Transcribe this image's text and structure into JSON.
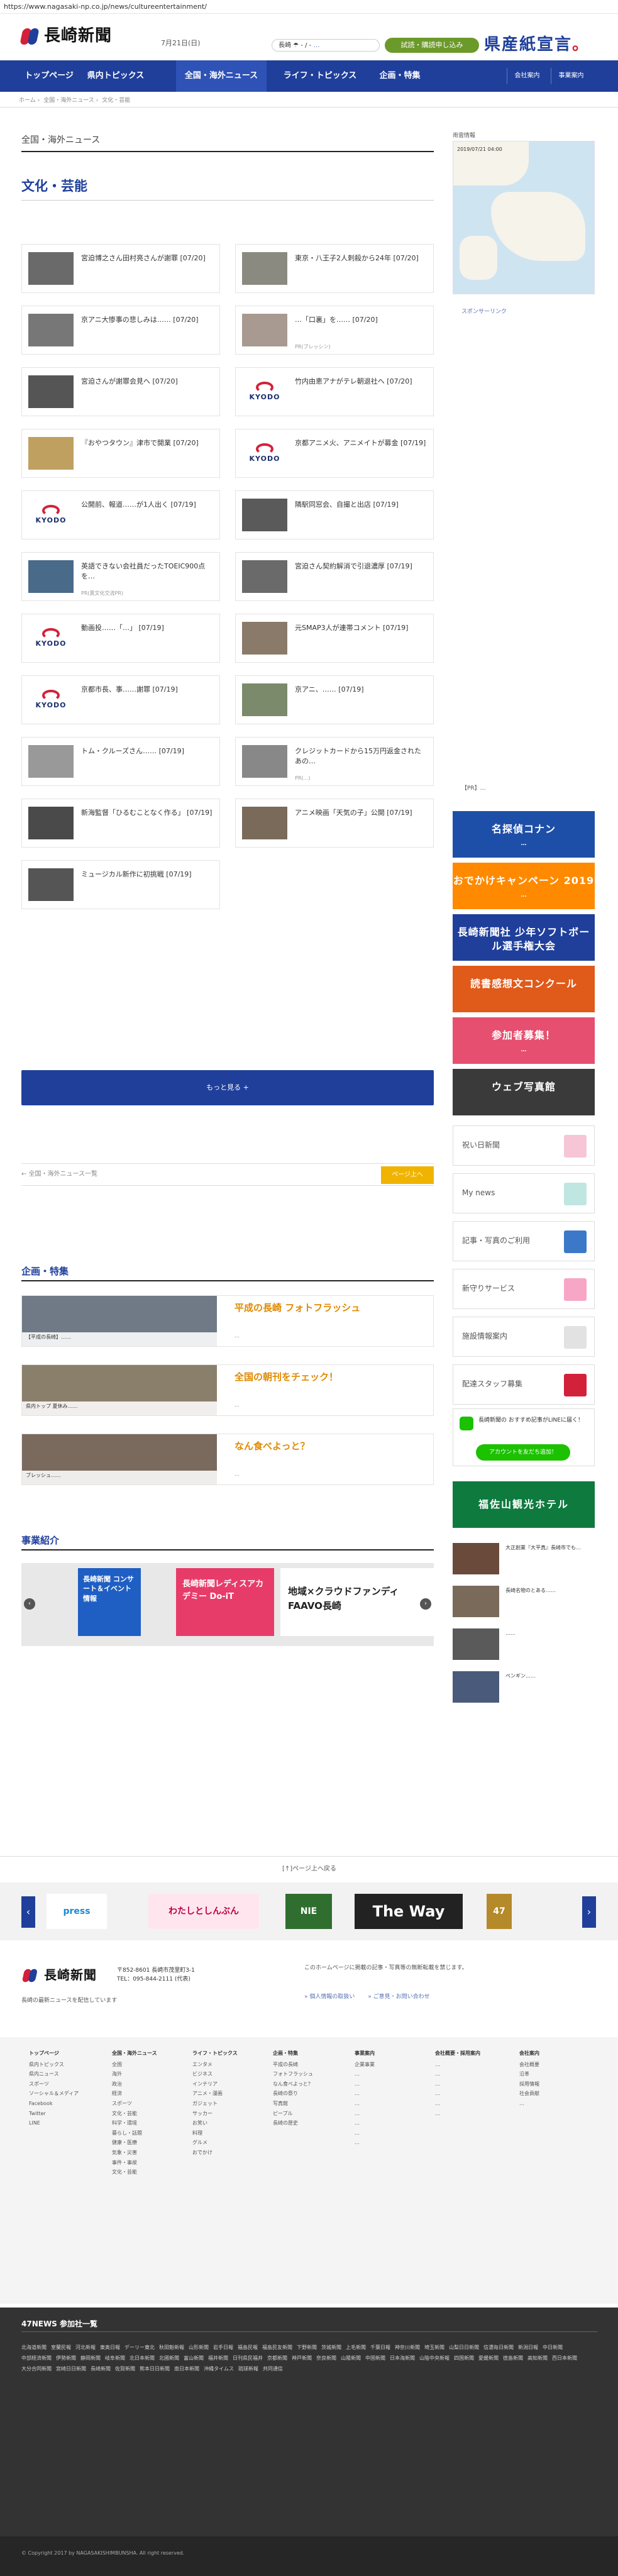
{
  "browser": {
    "url": "https://www.nagasaki-np.co.jp/news/cultureentertainment/"
  },
  "header": {
    "logo_text": "長崎新聞",
    "date": "7月21日(日)",
    "weather": "長崎 ☂ - / -",
    "weather_link": "…",
    "ad_pill": "試読・購読申し込み",
    "banner_main": "県産紙宣言",
    "banner_mark": "。"
  },
  "nav": {
    "items": [
      "トップページ",
      "県内トピックス",
      "全国・海外ニュース",
      "ライフ・トピックス",
      "企画・特集"
    ],
    "active_index": 2,
    "small": [
      "会社案内",
      "事業案内"
    ]
  },
  "breadcrumb": [
    "ホーム",
    "全国・海外ニュース",
    "文化・芸能"
  ],
  "main": {
    "section_label": "全国・海外ニュース",
    "category_title": "文化・芸能",
    "articles": [
      {
        "title": "宮迫博之さん田村亮さんが謝罪 [07/20]",
        "sub": "",
        "kyodo": false,
        "tone": "#6a6a6a"
      },
      {
        "title": "東京・八王子2人刺殺から24年 [07/20]",
        "sub": "",
        "kyodo": false,
        "tone": "#8a8a80"
      },
      {
        "title": "京アニ大惨事の悲しみは…… [07/20]",
        "sub": "",
        "kyodo": false,
        "tone": "#777"
      },
      {
        "title": "…「口裏」を…… [07/20]",
        "sub": "PR(ブレッシン)",
        "kyodo": false,
        "tone": "#a89a90"
      },
      {
        "title": "宮迫さんが謝罪会見へ [07/20]",
        "sub": "",
        "kyodo": false,
        "tone": "#555"
      },
      {
        "title": "竹内由恵アナがテレ朝退社へ [07/20]",
        "sub": "",
        "kyodo": true,
        "tone": ""
      },
      {
        "title": "『おやつタウン』津市で開業 [07/20]",
        "sub": "",
        "kyodo": false,
        "tone": "#c0a060"
      },
      {
        "title": "京都アニメ火、アニメイトが募金 [07/19]",
        "sub": "",
        "kyodo": true,
        "tone": ""
      },
      {
        "title": "公開前、報道……が1人出く [07/19]",
        "sub": "",
        "kyodo": true,
        "tone": ""
      },
      {
        "title": "隣駅同窓会、自撮と出店 [07/19]",
        "sub": "",
        "kyodo": false,
        "tone": "#5a5a5a"
      },
      {
        "title": "英語できない会社員だったTOEIC900点を…",
        "sub": "PR(異文化交流PR)",
        "kyodo": false,
        "tone": "#4a6a8a"
      },
      {
        "title": "宮迫さん契約解消で引退濃厚 [07/19]",
        "sub": "",
        "kyodo": false,
        "tone": "#6a6a6a"
      },
      {
        "title": "動画投……「…」 [07/19]",
        "sub": "",
        "kyodo": true,
        "tone": ""
      },
      {
        "title": "元SMAP3人が連帯コメント [07/19]",
        "sub": "",
        "kyodo": false,
        "tone": "#8a7a6a"
      },
      {
        "title": "京都市長、事……謝罪 [07/19]",
        "sub": "",
        "kyodo": true,
        "tone": ""
      },
      {
        "title": "京アニ、…… [07/19]",
        "sub": "",
        "kyodo": false,
        "tone": "#7a8a6a"
      },
      {
        "title": "トム・クルーズさん…… [07/19]",
        "sub": "",
        "kyodo": false,
        "tone": "#999"
      },
      {
        "title": "クレジットカードから15万円返金されたあの…",
        "sub": "PR(…)",
        "kyodo": false,
        "tone": "#888"
      },
      {
        "title": "新海監督「ひるむことなく作る」 [07/19]",
        "sub": "",
        "kyodo": false,
        "tone": "#4a4a4a"
      },
      {
        "title": "アニメ映画「天気の子」公開 [07/19]",
        "sub": "",
        "kyodo": false,
        "tone": "#7a6a5a"
      },
      {
        "title": "ミュージカル新作に初挑戦 [07/19]",
        "sub": "",
        "kyodo": false,
        "tone": "#555"
      }
    ],
    "more_button": "もっと見る +",
    "pager_prev": "← 全国・海外ニュース一覧",
    "pager_next": "ページ上へ"
  },
  "features": {
    "heading": "企画・特集",
    "items": [
      {
        "caption": "【平成の長崎】……",
        "title": "平成の長崎 フォトフラッシュ",
        "desc": "…"
      },
      {
        "caption": "県内トップ 夏休み……",
        "title": "全国の朝刊をチェック！",
        "desc": "…"
      },
      {
        "caption": "ブレッシュ……",
        "title": "なん食べよっと？",
        "desc": "…"
      }
    ]
  },
  "business": {
    "heading": "事業紹介",
    "tiles": [
      {
        "text": "長崎新聞 コンサート＆イベント情報",
        "bg": "#1f5fc4"
      },
      {
        "text": "長崎新聞レディスアカデミー Do-iT",
        "bg": "#e73c6a"
      },
      {
        "text": "地域×クラウドファンディ FAAVO長崎",
        "bg": "#ffffff"
      }
    ]
  },
  "sidebar": {
    "map_title": "雨雲情報",
    "map_time": "2019/07/21 04:00",
    "sponsor_label": "スポンサーリンク",
    "text_ad": "【PR】…",
    "banners": [
      {
        "title": "名探偵コナン",
        "sub": "…",
        "bg": "#1e4fa8"
      },
      {
        "title": "おでかけキャンペーン 2019",
        "sub": "…",
        "bg": "#ff8a00"
      },
      {
        "title": "長崎新聞社 少年ソフトボール選手権大会",
        "sub": "…",
        "bg": "#1f3f9b"
      },
      {
        "title": "読書感想文コンクール",
        "sub": "",
        "bg": "#e05a1a"
      },
      {
        "title": "参加者募集！",
        "sub": "…",
        "bg": "#e64f6f"
      },
      {
        "title": "ウェブ写真館",
        "sub": "",
        "bg": "#3a3a3a"
      }
    ],
    "buttons": [
      {
        "label": "祝い日新聞",
        "icon": "#f7c6d6"
      },
      {
        "label": "My news",
        "icon": "#bfe6e0"
      },
      {
        "label": "記事・写真のご利用",
        "icon": "#3b79c8"
      },
      {
        "label": "新守りサービス",
        "icon": "#f7a6c6"
      },
      {
        "label": "施設情報案内",
        "icon": "#e2e2e2"
      },
      {
        "label": "配達スタッフ募集",
        "icon": "#d3213a"
      }
    ],
    "line_box": {
      "title": "長崎新聞の おすすめ記事がLINEに届く！",
      "button": "アカウントを友だち追加！"
    },
    "hotel": {
      "title": "福佐山観光ホテル"
    },
    "news": [
      {
        "text": "大正創業『大平真』長崎市でも…",
        "tone": "#6a4a3a"
      },
      {
        "text": "長崎名物のとある……",
        "tone": "#7a6a5a"
      },
      {
        "text": "……",
        "tone": "#5a5a5a"
      },
      {
        "text": "ペンギン……",
        "tone": "#4a5a7a"
      }
    ]
  },
  "footer": {
    "back_to_top": "[↑]ページ上へ戻る",
    "carousel": [
      {
        "text": "press",
        "bg": "#ffffff",
        "fg": "#1a8ad6"
      },
      {
        "text": "わたしとしんぶん",
        "bg": "#ffe6ee",
        "fg": "#b04"
      },
      {
        "text": "NIE",
        "bg": "#2f6e2f",
        "fg": "#fff"
      },
      {
        "text": "The Way",
        "bg": "#222222",
        "fg": "#fff"
      },
      {
        "text": "47",
        "bg": "#b58a2a",
        "fg": "#fff"
      }
    ],
    "logo_text": "長崎新聞",
    "address_lines": [
      "〒852-8601 長崎市茂里町3-1",
      "TEL：095-844-2111 (代表)"
    ],
    "note": "長崎の最新ニュースを配信しています",
    "desc": "このホームページに掲載の記事・写真等の無断転載を禁じます。",
    "links": [
      "» 個人情報の取扱い",
      "» ご意見・お問い合わせ"
    ],
    "sitemap": [
      {
        "head": "トップページ",
        "items": [
          "県内トピックス",
          "県内ニュース",
          "スポーツ",
          "ソーシャル＆メディア",
          "Facebook",
          "Twitter",
          "LINE"
        ]
      },
      {
        "head": "全国・海外ニュース",
        "items": [
          "全国",
          "海外",
          "政治",
          "経済",
          "スポーツ",
          "文化・芸能",
          "科学・環境",
          "暮らし・話題",
          "健康・医療",
          "気象・災害",
          "事件・事故",
          "文化・芸能"
        ]
      },
      {
        "head": "ライフ・トピックス",
        "items": [
          "エンタメ",
          "ビジネス",
          "インテリア",
          "アニメ・漫画",
          "ガジェット",
          "サッカー",
          "お笑い",
          "料理",
          "グルメ",
          "おでかけ"
        ]
      },
      {
        "head": "企画・特集",
        "items": [
          "平成の長崎",
          "フォトフラッシュ",
          "なん食べよっと？",
          "長崎の祭り",
          "写真館",
          "ピープル",
          "長崎の歴史"
        ]
      },
      {
        "head": "事業案内",
        "items": [
          "企業事業",
          "…",
          "…",
          "…",
          "…",
          "…",
          "…",
          "…",
          "…"
        ]
      },
      {
        "head": "会社概要・採用案内",
        "items": [
          "…",
          "…",
          "…",
          "…",
          "…",
          "…"
        ]
      },
      {
        "head": "会社案内",
        "items": [
          "会社概要",
          "沿革",
          "採用情報",
          "社会貢献",
          "…"
        ]
      }
    ],
    "network_title": "47NEWS 参加社一覧",
    "network": [
      "北海道新聞",
      "室蘭民報",
      "河北新報",
      "東奥日報",
      "デーリー東北",
      "秋田魁新報",
      "山形新聞",
      "岩手日報",
      "福島民報",
      "福島民友新聞",
      "下野新聞",
      "茨城新聞",
      "上毛新聞",
      "千葉日報",
      "神奈川新聞",
      "埼玉新聞",
      "山梨日日新聞",
      "信濃毎日新聞",
      "新潟日報",
      "中日新聞",
      "中部経済新聞",
      "伊勢新聞",
      "静岡新聞",
      "岐阜新聞",
      "北日本新聞",
      "北國新聞",
      "富山新聞",
      "福井新聞",
      "日刊県民福井",
      "京都新聞",
      "神戸新聞",
      "奈良新聞",
      "山陽新聞",
      "中国新聞",
      "日本海新聞",
      "山陰中央新報",
      "四国新聞",
      "愛媛新聞",
      "徳島新聞",
      "高知新聞",
      "西日本新聞",
      "大分合同新聞",
      "宮崎日日新聞",
      "長崎新聞",
      "佐賀新聞",
      "熊本日日新聞",
      "南日本新聞",
      "沖縄タイムス",
      "琉球新報",
      "共同通信"
    ],
    "copyright": "© Copyright 2017 by NAGASAKISHIMBUNSHA. All right reserved."
  }
}
